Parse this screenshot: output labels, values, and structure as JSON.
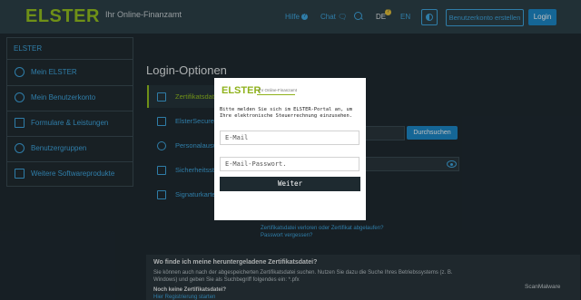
{
  "header": {
    "logo": "ELSTER",
    "logo_subtitle": "Ihr Online-Finanzamt",
    "help_label": "Hilfe",
    "help_icon": "?",
    "chat_label": "Chat",
    "search_icon": "search-icon",
    "lang_de": "DE",
    "lang_de_badge": "?",
    "lang_en": "EN",
    "register_button": "Benutzerkonto erstellen",
    "login_button": "Login"
  },
  "sidebar": {
    "title": "ELSTER",
    "items": [
      {
        "label": "Mein ELSTER",
        "icon": "user-icon"
      },
      {
        "label": "Mein Benutzerkonto",
        "icon": "gear-icon"
      },
      {
        "label": "Formulare & Leistungen",
        "icon": "documents-icon"
      },
      {
        "label": "Benutzergruppen",
        "icon": "users-icon"
      },
      {
        "label": "Weitere Softwareprodukte",
        "icon": "network-icon"
      }
    ]
  },
  "main": {
    "title": "Login-Optionen",
    "tabs": [
      {
        "label": "Zertifikatsdatei",
        "active": true
      },
      {
        "label": "ElsterSecure",
        "active": false
      },
      {
        "label": "Personalausweis",
        "active": false
      },
      {
        "label": "Sicherheitsstick",
        "active": false
      },
      {
        "label": "Signaturkarte",
        "active": false
      }
    ],
    "search_button": "Durchsuchen",
    "link_lost": "Zertifikatsdatei verloren oder Zertifikat abgelaufen?",
    "link_password": "Passwort vergessen?"
  },
  "info": {
    "title": "Wo finde ich meine heruntergeladene Zertifikatsdatei?",
    "text": "Sie können auch nach der abgespeicherten Zertifikatsdatei suchen. Nutzen Sie dazu die Suche Ihres Betriebssystems (z. B. Windows) und geben Sie als Suchbegriff folgendes ein: *.pfx",
    "subtitle": "Noch keine Zertifikatsdatei?",
    "link": "Hier Registrierung starten"
  },
  "watermark": "ScanMalware",
  "modal": {
    "logo": "ELSTER",
    "logo_subtitle": "Ihr Online-Finanzamt",
    "message": "Bitte melden Sie sich im ELSTER-Portal an, um Ihre elektronische Steuerrechnung einzusehen.",
    "email_placeholder": "E-Mail",
    "password_placeholder": "E-Mail-Passwort.",
    "submit_label": "Weiter"
  }
}
